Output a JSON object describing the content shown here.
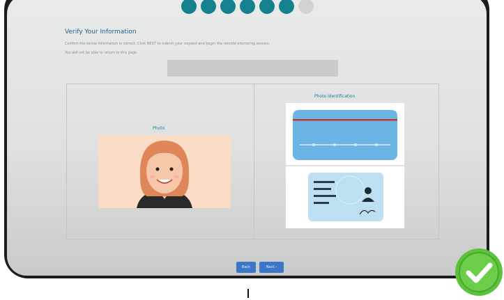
{
  "stepper": {
    "total_steps": 7,
    "completed_steps": 6
  },
  "page": {
    "title": "Verify Your Information",
    "instruction_1": "Confirm the below information is correct. Click NEXT to submit your request and begin the remote proctoring session.",
    "instruction_2": "You will not be able to return to this page."
  },
  "panels": {
    "photo_label": "Photo",
    "id_label": "Photo Identification"
  },
  "buttons": {
    "back": "Back",
    "next": "Next ›"
  },
  "overlay": {
    "icon": "checkmark-badge-icon",
    "color": "#5cc13b"
  },
  "colors": {
    "accent": "#15808f",
    "button": "#3d76c6"
  }
}
